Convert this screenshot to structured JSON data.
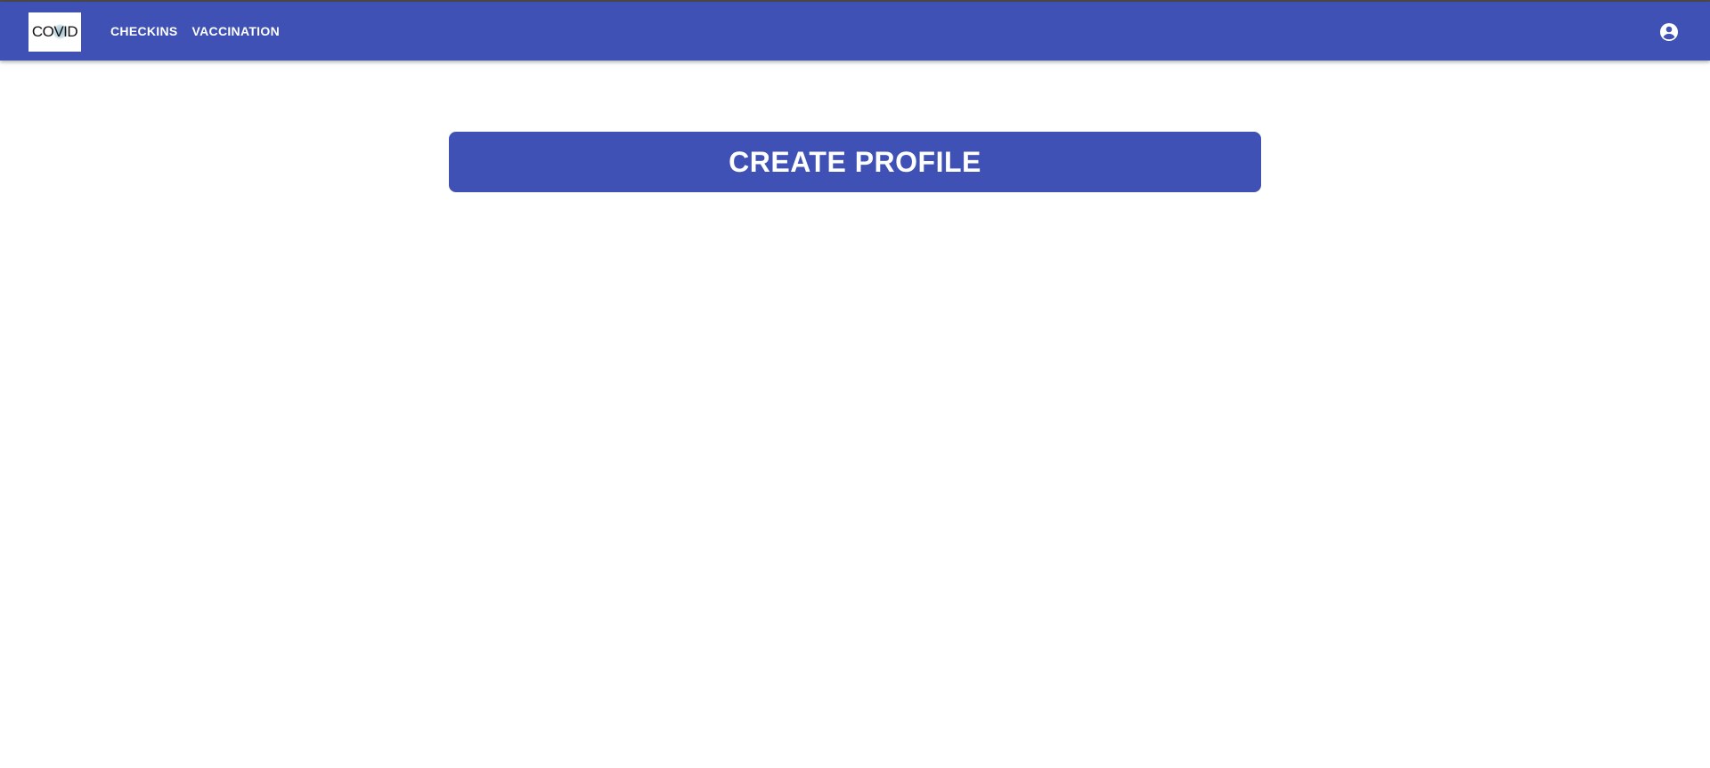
{
  "header": {
    "logo_text": "COVID",
    "nav": [
      {
        "label": "CHECKINS"
      },
      {
        "label": "VACCINATION"
      }
    ],
    "account_icon": "account-circle-icon"
  },
  "main": {
    "create_profile_label": "CREATE PROFILE"
  },
  "colors": {
    "primary": "#3f51b5",
    "background": "#ffffff",
    "text_on_primary": "#ffffff"
  }
}
